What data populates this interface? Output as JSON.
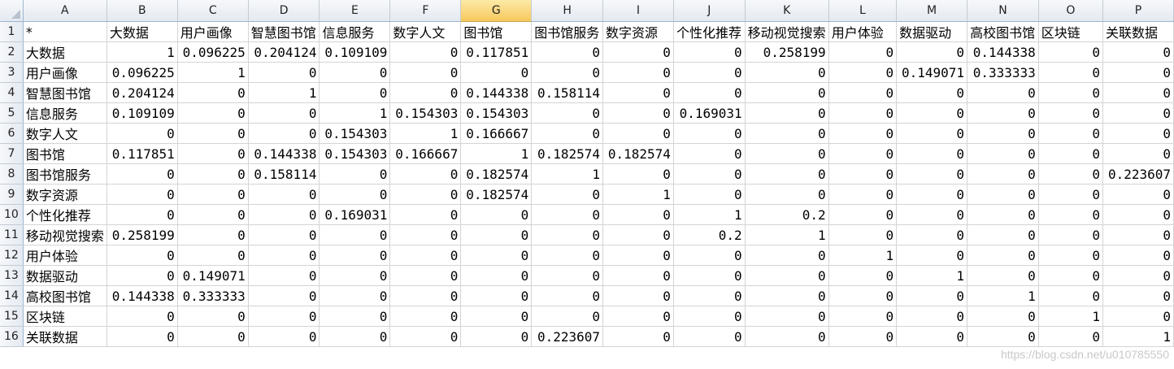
{
  "sheet": {
    "selected_column": "G",
    "corner": "",
    "columns": [
      "A",
      "B",
      "C",
      "D",
      "E",
      "F",
      "G",
      "H",
      "I",
      "J",
      "K",
      "L",
      "M",
      "N",
      "O",
      "P"
    ],
    "rows": [
      {
        "num": "1",
        "cells": [
          "*",
          "大数据",
          "用户画像",
          "智慧图书馆",
          "信息服务",
          "数字人文",
          "图书馆",
          "图书馆服务",
          "数字资源",
          "个性化推荐",
          "移动视觉搜索",
          "用户体验",
          "数据驱动",
          "高校图书馆",
          "区块链",
          "关联数据"
        ]
      },
      {
        "num": "2",
        "cells": [
          "大数据",
          "1",
          "0.096225",
          "0.204124",
          "0.109109",
          "0",
          "0.117851",
          "0",
          "0",
          "0",
          "0.258199",
          "0",
          "0",
          "0.144338",
          "0",
          "0"
        ]
      },
      {
        "num": "3",
        "cells": [
          "用户画像",
          "0.096225",
          "1",
          "0",
          "0",
          "0",
          "0",
          "0",
          "0",
          "0",
          "0",
          "0",
          "0.149071",
          "0.333333",
          "0",
          "0"
        ]
      },
      {
        "num": "4",
        "cells": [
          "智慧图书馆",
          "0.204124",
          "0",
          "1",
          "0",
          "0",
          "0.144338",
          "0.158114",
          "0",
          "0",
          "0",
          "0",
          "0",
          "0",
          "0",
          "0"
        ]
      },
      {
        "num": "5",
        "cells": [
          "信息服务",
          "0.109109",
          "0",
          "0",
          "1",
          "0.154303",
          "0.154303",
          "0",
          "0",
          "0.169031",
          "0",
          "0",
          "0",
          "0",
          "0",
          "0"
        ]
      },
      {
        "num": "6",
        "cells": [
          "数字人文",
          "0",
          "0",
          "0",
          "0.154303",
          "1",
          "0.166667",
          "0",
          "0",
          "0",
          "0",
          "0",
          "0",
          "0",
          "0",
          "0"
        ]
      },
      {
        "num": "7",
        "cells": [
          "图书馆",
          "0.117851",
          "0",
          "0.144338",
          "0.154303",
          "0.166667",
          "1",
          "0.182574",
          "0.182574",
          "0",
          "0",
          "0",
          "0",
          "0",
          "0",
          "0"
        ]
      },
      {
        "num": "8",
        "cells": [
          "图书馆服务",
          "0",
          "0",
          "0.158114",
          "0",
          "0",
          "0.182574",
          "1",
          "0",
          "0",
          "0",
          "0",
          "0",
          "0",
          "0",
          "0.223607"
        ]
      },
      {
        "num": "9",
        "cells": [
          "数字资源",
          "0",
          "0",
          "0",
          "0",
          "0",
          "0.182574",
          "0",
          "1",
          "0",
          "0",
          "0",
          "0",
          "0",
          "0",
          "0"
        ]
      },
      {
        "num": "10",
        "cells": [
          "个性化推荐",
          "0",
          "0",
          "0",
          "0.169031",
          "0",
          "0",
          "0",
          "0",
          "1",
          "0.2",
          "0",
          "0",
          "0",
          "0",
          "0"
        ]
      },
      {
        "num": "11",
        "cells": [
          "移动视觉搜索",
          "0.258199",
          "0",
          "0",
          "0",
          "0",
          "0",
          "0",
          "0",
          "0.2",
          "1",
          "0",
          "0",
          "0",
          "0",
          "0"
        ]
      },
      {
        "num": "12",
        "cells": [
          "用户体验",
          "0",
          "0",
          "0",
          "0",
          "0",
          "0",
          "0",
          "0",
          "0",
          "0",
          "1",
          "0",
          "0",
          "0",
          "0"
        ]
      },
      {
        "num": "13",
        "cells": [
          "数据驱动",
          "0",
          "0.149071",
          "0",
          "0",
          "0",
          "0",
          "0",
          "0",
          "0",
          "0",
          "0",
          "1",
          "0",
          "0",
          "0"
        ]
      },
      {
        "num": "14",
        "cells": [
          "高校图书馆",
          "0.144338",
          "0.333333",
          "0",
          "0",
          "0",
          "0",
          "0",
          "0",
          "0",
          "0",
          "0",
          "0",
          "1",
          "0",
          "0"
        ]
      },
      {
        "num": "15",
        "cells": [
          "区块链",
          "0",
          "0",
          "0",
          "0",
          "0",
          "0",
          "0",
          "0",
          "0",
          "0",
          "0",
          "0",
          "0",
          "1",
          "0"
        ]
      },
      {
        "num": "16",
        "cells": [
          "关联数据",
          "0",
          "0",
          "0",
          "0",
          "0",
          "0",
          "0.223607",
          "0",
          "0",
          "0",
          "0",
          "0",
          "0",
          "0",
          "1"
        ]
      }
    ]
  },
  "watermark": "https://blog.csdn.net/u010785550"
}
